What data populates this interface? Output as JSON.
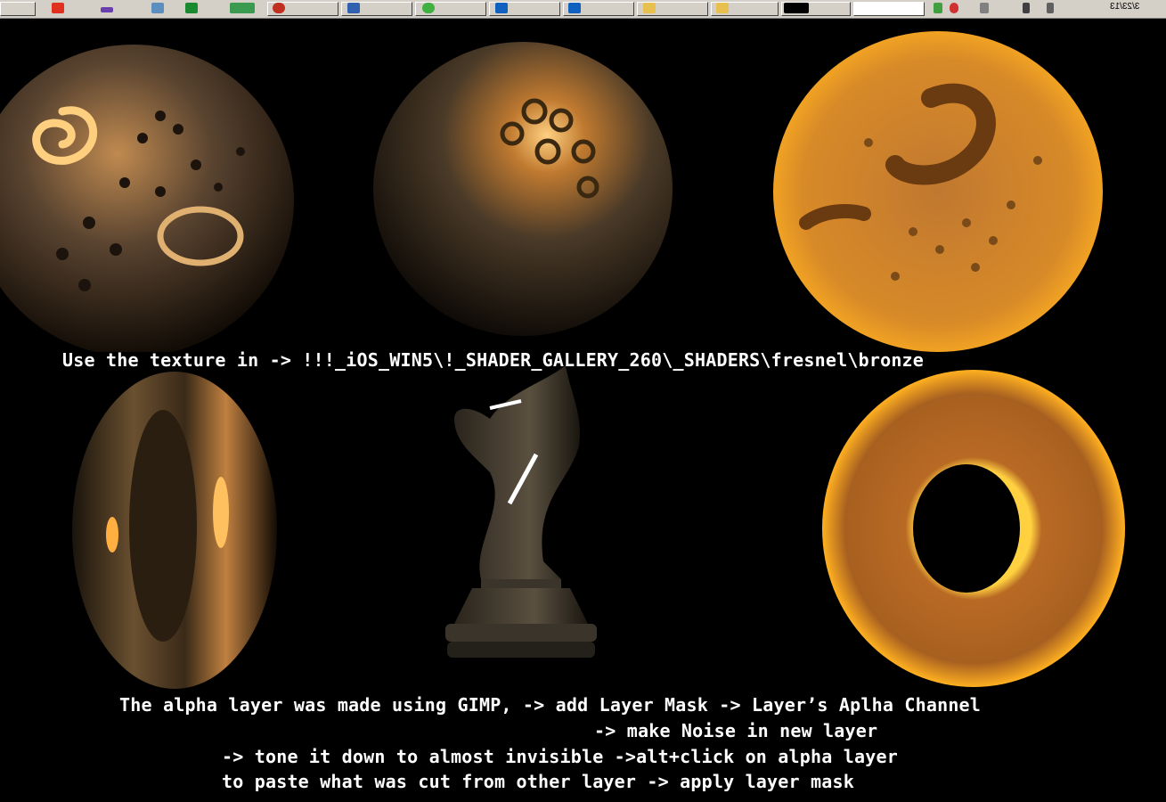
{
  "taskbar": {
    "tray_time": "3/23/13"
  },
  "captions": {
    "texture_path": "Use the texture in -> !!!_iOS_WIN5\\!_SHADER_GALLERY_260\\_SHADERS\\fresnel\\bronze",
    "note_line_1": "The alpha layer was made using GIMP, -> add Layer Mask -> Layer’s Aplha Channel",
    "note_line_2": "-> make Noise in new layer",
    "note_line_3": "-> tone it down to almost invisible ->alt+click on alpha layer",
    "note_line_4": "to paste what was cut from other layer -> apply layer mask"
  },
  "colors": {
    "background": "#000000",
    "bronze_dark": "#3a2a1a",
    "bronze_light": "#ffb040",
    "gold_orange": "#e07a10"
  },
  "renders": [
    {
      "icon": "bronze-sphere-swirl"
    },
    {
      "icon": "bronze-sphere-dimpled"
    },
    {
      "icon": "orange-sphere-fresnel"
    },
    {
      "icon": "bronze-torus-side"
    },
    {
      "icon": "bronze-chess-knight"
    },
    {
      "icon": "orange-torus-front"
    }
  ]
}
